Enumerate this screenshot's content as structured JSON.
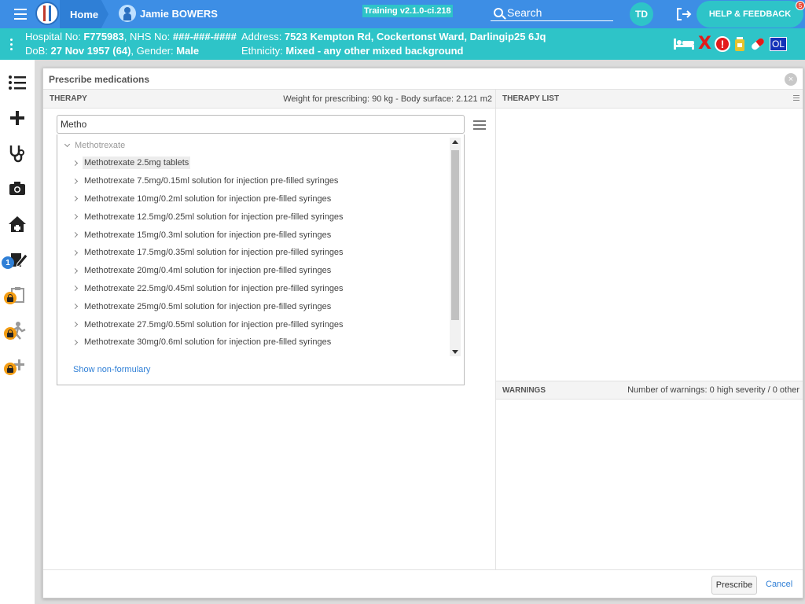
{
  "topbar": {
    "home_label": "Home",
    "patient_name": "Jamie BOWERS",
    "training_label": "Training v2.1.0-ci.218",
    "search_label": "Search",
    "user_initials": "TD",
    "help_label": "HELP & FEEDBACK",
    "help_badge": "5"
  },
  "banner": {
    "hospital_label": "Hospital No: ",
    "hospital_no": "F775983",
    "nhs_label": ", NHS No: ",
    "nhs_no": "###-###-####",
    "address_label": "Address: ",
    "address": "7523 Kempton Rd, Cockertonst Ward, Darlingip25 6Jq",
    "dob_label": "DoB: ",
    "dob": "27 Nov 1957 (64)",
    "gender_label": ", Gender: ",
    "gender": "Male",
    "ethnicity_label": "Ethnicity: ",
    "ethnicity": "Mixed - any other mixed background",
    "alert_x": "X",
    "alert_exclaim": "!",
    "ol_label": "OL"
  },
  "sidebar": {
    "badge_count": "1"
  },
  "modal": {
    "title": "Prescribe medications",
    "close": "×",
    "therapy_heading": "THERAPY",
    "weight_info": "Weight for prescribing: 90 kg - Body surface: 2.121 m2",
    "therapy_list_heading": "THERAPY LIST",
    "warnings_heading": "WARNINGS",
    "warnings_info": "Number of warnings: 0 high severity / 0 other",
    "search_value": "Metho",
    "group_label": "Methotrexate",
    "items": [
      "Methotrexate 2.5mg tablets",
      "Methotrexate 7.5mg/0.15ml solution for injection pre-filled syringes",
      "Methotrexate 10mg/0.2ml solution for injection pre-filled syringes",
      "Methotrexate 12.5mg/0.25ml solution for injection pre-filled syringes",
      "Methotrexate 15mg/0.3ml solution for injection pre-filled syringes",
      "Methotrexate 17.5mg/0.35ml solution for injection pre-filled syringes",
      "Methotrexate 20mg/0.4ml solution for injection pre-filled syringes",
      "Methotrexate 22.5mg/0.45ml solution for injection pre-filled syringes",
      "Methotrexate 25mg/0.5ml solution for injection pre-filled syringes",
      "Methotrexate 27.5mg/0.55ml solution for injection pre-filled syringes",
      "Methotrexate 30mg/0.6ml solution for injection pre-filled syringes"
    ],
    "show_non_formulary": "Show non-formulary",
    "prescribe_label": "Prescribe",
    "cancel_label": "Cancel"
  },
  "colors": {
    "topbar": "#3d8ee5",
    "banner": "#2ec4c8",
    "link": "#2f7fd6",
    "lock_badge": "#f39c12"
  }
}
